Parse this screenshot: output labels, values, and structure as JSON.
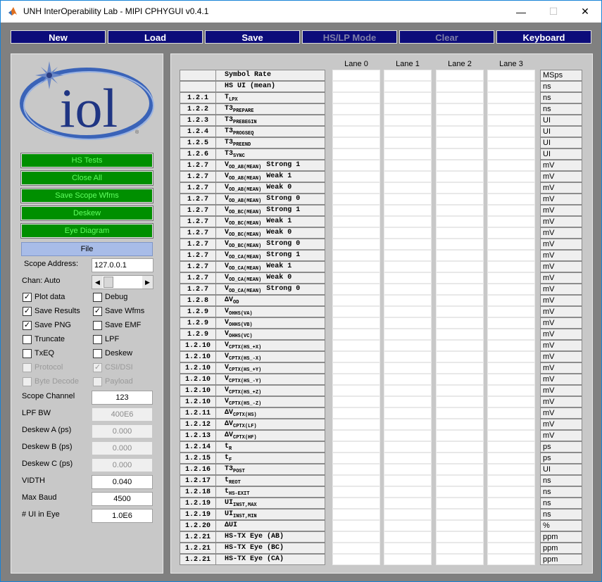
{
  "window": {
    "title": "UNH InterOperability Lab - MIPI CPHYGUI v0.4.1",
    "min": "—",
    "max": "☐",
    "close": "✕"
  },
  "toolbar": [
    {
      "label": "New",
      "enabled": true
    },
    {
      "label": "Load",
      "enabled": true
    },
    {
      "label": "Save",
      "enabled": true
    },
    {
      "label": "HS/LP Mode",
      "enabled": false
    },
    {
      "label": "Clear",
      "enabled": false
    },
    {
      "label": "Keyboard",
      "enabled": true
    }
  ],
  "logo": {
    "text": "iol",
    "reg": "®"
  },
  "actions": [
    {
      "label": "HS Tests"
    },
    {
      "label": "Close All"
    },
    {
      "label": "Save Scope Wfms"
    },
    {
      "label": "Deskew"
    },
    {
      "label": "Eye Diagram"
    }
  ],
  "file_label": "File",
  "scope_address": {
    "label": "Scope Address:",
    "value": "127.0.0.1"
  },
  "chan": {
    "label": "Chan: Auto"
  },
  "checkboxes": [
    {
      "label": "Plot data",
      "checked": true,
      "enabled": true
    },
    {
      "label": "Debug",
      "checked": false,
      "enabled": true
    },
    {
      "label": "Save Results",
      "checked": true,
      "enabled": true
    },
    {
      "label": "Save Wfms",
      "checked": true,
      "enabled": true
    },
    {
      "label": "Save PNG",
      "checked": true,
      "enabled": true
    },
    {
      "label": "Save EMF",
      "checked": false,
      "enabled": true
    },
    {
      "label": "Truncate",
      "checked": false,
      "enabled": true
    },
    {
      "label": "LPF",
      "checked": false,
      "enabled": true
    },
    {
      "label": "TxEQ",
      "checked": false,
      "enabled": true
    },
    {
      "label": "Deskew",
      "checked": false,
      "enabled": true
    },
    {
      "label": "Protocol",
      "checked": false,
      "enabled": false
    },
    {
      "label": "CSI/DSI",
      "checked": true,
      "enabled": false
    },
    {
      "label": "Byte Decode",
      "checked": false,
      "enabled": false
    },
    {
      "label": "Payload",
      "checked": false,
      "enabled": false
    }
  ],
  "fields": [
    {
      "label": "Scope Channel",
      "value": "123",
      "readonly": false
    },
    {
      "label": "LPF BW",
      "value": "400E6",
      "readonly": true
    },
    {
      "label": "Deskew A (ps)",
      "value": "0.000",
      "readonly": true
    },
    {
      "label": "Deskew B (ps)",
      "value": "0.000",
      "readonly": true
    },
    {
      "label": "Deskew C (ps)",
      "value": "0.000",
      "readonly": true
    },
    {
      "label": "VIDTH",
      "value": "0.040",
      "readonly": false
    },
    {
      "label": "Max Baud",
      "value": "4500",
      "readonly": false
    },
    {
      "label": "# UI in Eye",
      "value": "1.0E6",
      "readonly": false
    }
  ],
  "lanes": [
    "Lane 0",
    "Lane 1",
    "Lane 2",
    "Lane 3"
  ],
  "rows": [
    {
      "num": "",
      "name": "Symbol Rate",
      "sub": "",
      "suffix": "",
      "unit": "MSps"
    },
    {
      "num": "",
      "name": "HS UI (mean)",
      "sub": "",
      "suffix": "",
      "unit": "ns"
    },
    {
      "num": "1.2.1",
      "name": "T",
      "sub": "LPX",
      "suffix": "",
      "unit": "ns"
    },
    {
      "num": "1.2.2",
      "name": "T3",
      "sub": "PREPARE",
      "suffix": "",
      "unit": "ns"
    },
    {
      "num": "1.2.3",
      "name": "T3",
      "sub": "PREBEGIN",
      "suffix": "",
      "unit": "UI"
    },
    {
      "num": "1.2.4",
      "name": "T3",
      "sub": "PROGSEQ",
      "suffix": "",
      "unit": "UI"
    },
    {
      "num": "1.2.5",
      "name": "T3",
      "sub": "PREEND",
      "suffix": "",
      "unit": "UI"
    },
    {
      "num": "1.2.6",
      "name": "T3",
      "sub": "SYNC",
      "suffix": "",
      "unit": "UI"
    },
    {
      "num": "1.2.7",
      "name": "V",
      "sub": "OD_AB(MEAN)",
      "suffix": "Strong 1",
      "unit": "mV"
    },
    {
      "num": "1.2.7",
      "name": "V",
      "sub": "OD_AB(MEAN)",
      "suffix": "Weak 1",
      "unit": "mV"
    },
    {
      "num": "1.2.7",
      "name": "V",
      "sub": "OD_AB(MEAN)",
      "suffix": "Weak 0",
      "unit": "mV"
    },
    {
      "num": "1.2.7",
      "name": "V",
      "sub": "OD_AB(MEAN)",
      "suffix": "Strong 0",
      "unit": "mV"
    },
    {
      "num": "1.2.7",
      "name": "V",
      "sub": "OD_BC(MEAN)",
      "suffix": "Strong 1",
      "unit": "mV"
    },
    {
      "num": "1.2.7",
      "name": "V",
      "sub": "OD_BC(MEAN)",
      "suffix": "Weak 1",
      "unit": "mV"
    },
    {
      "num": "1.2.7",
      "name": "V",
      "sub": "OD_BC(MEAN)",
      "suffix": "Weak 0",
      "unit": "mV"
    },
    {
      "num": "1.2.7",
      "name": "V",
      "sub": "OD_BC(MEAN)",
      "suffix": "Strong 0",
      "unit": "mV"
    },
    {
      "num": "1.2.7",
      "name": "V",
      "sub": "OD_CA(MEAN)",
      "suffix": "Strong 1",
      "unit": "mV"
    },
    {
      "num": "1.2.7",
      "name": "V",
      "sub": "OD_CA(MEAN)",
      "suffix": "Weak 1",
      "unit": "mV"
    },
    {
      "num": "1.2.7",
      "name": "V",
      "sub": "OD_CA(MEAN)",
      "suffix": "Weak 0",
      "unit": "mV"
    },
    {
      "num": "1.2.7",
      "name": "V",
      "sub": "OD_CA(MEAN)",
      "suffix": "Strong 0",
      "unit": "mV"
    },
    {
      "num": "1.2.8",
      "name": "ΔV",
      "sub": "OD",
      "suffix": "",
      "unit": "mV"
    },
    {
      "num": "1.2.9",
      "name": "V",
      "sub": "OHHS(VA)",
      "suffix": "",
      "unit": "mV"
    },
    {
      "num": "1.2.9",
      "name": "V",
      "sub": "OHHS(VB)",
      "suffix": "",
      "unit": "mV"
    },
    {
      "num": "1.2.9",
      "name": "V",
      "sub": "OHHS(VC)",
      "suffix": "",
      "unit": "mV"
    },
    {
      "num": "1.2.10",
      "name": "V",
      "sub": "CPTX(HS_+X)",
      "suffix": "",
      "unit": "mV"
    },
    {
      "num": "1.2.10",
      "name": "V",
      "sub": "CPTX(HS_-X)",
      "suffix": "",
      "unit": "mV"
    },
    {
      "num": "1.2.10",
      "name": "V",
      "sub": "CPTX(HS_+Y)",
      "suffix": "",
      "unit": "mV"
    },
    {
      "num": "1.2.10",
      "name": "V",
      "sub": "CPTX(HS_-Y)",
      "suffix": "",
      "unit": "mV"
    },
    {
      "num": "1.2.10",
      "name": "V",
      "sub": "CPTX(HS_+Z)",
      "suffix": "",
      "unit": "mV"
    },
    {
      "num": "1.2.10",
      "name": "V",
      "sub": "CPTX(HS_-Z)",
      "suffix": "",
      "unit": "mV"
    },
    {
      "num": "1.2.11",
      "name": "ΔV",
      "sub": "CPTX(HS)",
      "suffix": "",
      "unit": "mV"
    },
    {
      "num": "1.2.12",
      "name": "ΔV",
      "sub": "CPTX(LF)",
      "suffix": "",
      "unit": "mV"
    },
    {
      "num": "1.2.13",
      "name": "ΔV",
      "sub": "CPTX(HF)",
      "suffix": "",
      "unit": "mV"
    },
    {
      "num": "1.2.14",
      "name": "t",
      "sub": "R",
      "suffix": "",
      "unit": "ps"
    },
    {
      "num": "1.2.15",
      "name": "t",
      "sub": "F",
      "suffix": "",
      "unit": "ps"
    },
    {
      "num": "1.2.16",
      "name": "T3",
      "sub": "POST",
      "suffix": "",
      "unit": "UI"
    },
    {
      "num": "1.2.17",
      "name": "t",
      "sub": "REOT",
      "suffix": "",
      "unit": "ns"
    },
    {
      "num": "1.2.18",
      "name": "t",
      "sub": "HS-EXIT",
      "suffix": "",
      "unit": "ns"
    },
    {
      "num": "1.2.19",
      "name": "UI",
      "sub": "INST,MAX",
      "suffix": "",
      "unit": "ns"
    },
    {
      "num": "1.2.19",
      "name": "UI",
      "sub": "INST,MIN",
      "suffix": "",
      "unit": "ns"
    },
    {
      "num": "1.2.20",
      "name": "ΔUI",
      "sub": "",
      "suffix": "",
      "unit": "%"
    },
    {
      "num": "1.2.21",
      "name": "HS-TX Eye (AB)",
      "sub": "",
      "suffix": "",
      "unit": "ppm"
    },
    {
      "num": "1.2.21",
      "name": "HS-TX Eye (BC)",
      "sub": "",
      "suffix": "",
      "unit": "ppm"
    },
    {
      "num": "1.2.21",
      "name": "HS-TX Eye (CA)",
      "sub": "",
      "suffix": "",
      "unit": "ppm"
    }
  ]
}
